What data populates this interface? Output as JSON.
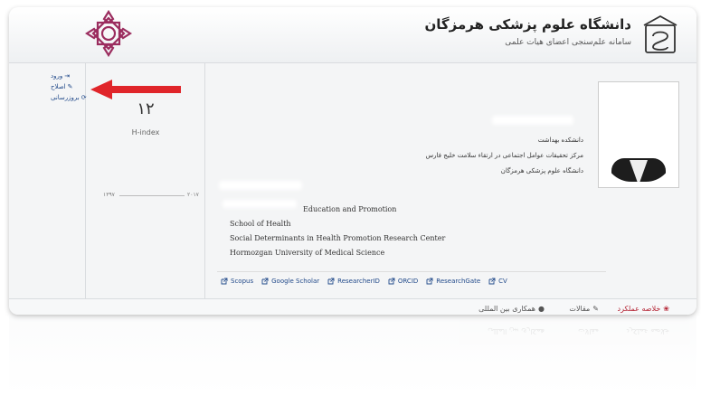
{
  "header": {
    "university_name": "دانشگاه علوم پزشکی هرمزگان",
    "system_name": "سامانه علم‌سنجی اعضای هیات علمی"
  },
  "side_links": [
    {
      "label": "ورود",
      "icon": "sign-in-icon"
    },
    {
      "label": "اصلاح",
      "icon": "pencil-icon"
    },
    {
      "label": "بروزرسانی",
      "icon": "refresh-icon"
    }
  ],
  "stats": {
    "h_index_value": "۱۲",
    "h_index_label": "H-index",
    "year_start": "۱۳۹۷",
    "year_end": "۲۰۱۷"
  },
  "profile_fa": [
    "دانشکده بهداشت",
    "مرکز تحقیقات عوامل اجتماعی در ارتقاء سلامت خلیج فارس",
    "دانشگاه علوم پزشکی هرمزگان"
  ],
  "profile_en": [
    "Education and Promotion",
    "School of Health",
    "Social Determinants in Health Promotion Research Center",
    "Hormozgan University of Medical Science"
  ],
  "external_links": [
    "Scopus",
    "Google Scholar",
    "ResearcherID",
    "ORCID",
    "ResearchGate",
    "CV"
  ],
  "tabs": [
    {
      "label": "خلاصه عملکرد",
      "icon": "users-icon",
      "color": "#b52535"
    },
    {
      "label": "مقالات",
      "icon": "pencil-icon"
    },
    {
      "label": "همکاری بین المللی",
      "icon": "globe-icon"
    }
  ],
  "colors": {
    "accent_red": "#b52535",
    "link_blue": "#224a8a",
    "arrow_red": "#e0252a",
    "logo_purple": "#9b2d5f"
  }
}
